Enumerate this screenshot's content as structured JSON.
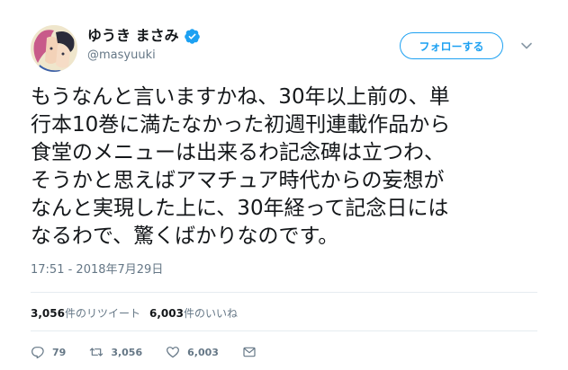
{
  "user": {
    "display_name": "ゆうき まさみ",
    "handle": "@masyuuki",
    "verified": true
  },
  "follow_button": {
    "label": "フォローする"
  },
  "tweet": {
    "lines": [
      "もうなんと言いますかね、30年以上前の、単",
      "行本10巻に満たなかった初週刊連載作品から",
      "食堂のメニューは出来るわ記念碑は立つわ、",
      "そうかと思えばアマチュア時代からの妄想が",
      "なんと実現した上に、30年経って記念日には",
      "なるわで、驚くばかりなのです。"
    ],
    "timestamp": "17:51 - 2018年7月29日"
  },
  "stats": {
    "retweets_count": "3,056",
    "retweets_label": "件のリツイート",
    "likes_count": "6,003",
    "likes_label": "件のいいね"
  },
  "actions": {
    "reply_count": "79",
    "retweet_count": "3,056",
    "like_count": "6,003"
  },
  "colors": {
    "accent": "#1da1f2",
    "text": "#14171a",
    "muted": "#657786",
    "divider": "#e6ecf0"
  },
  "icons": [
    "verified-badge-icon",
    "chevron-down-icon",
    "reply-icon",
    "retweet-icon",
    "like-icon",
    "message-icon"
  ]
}
